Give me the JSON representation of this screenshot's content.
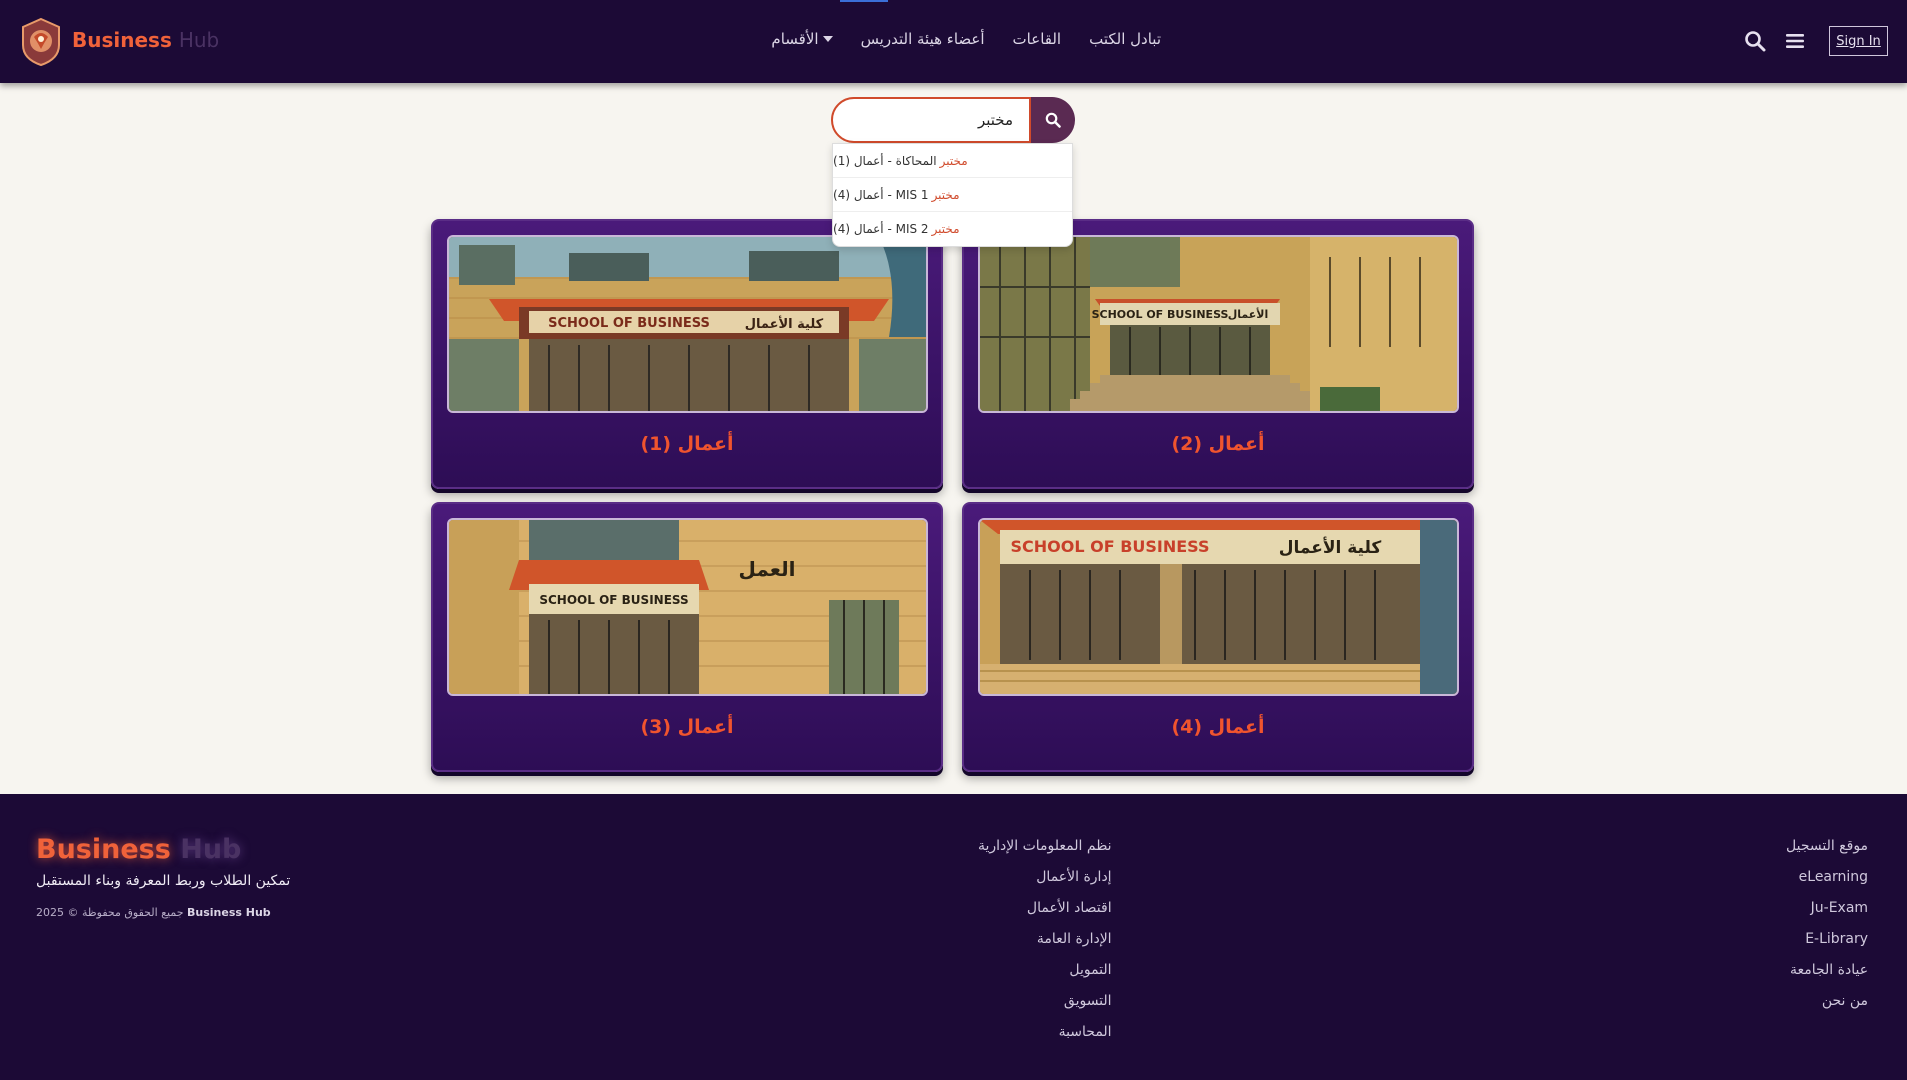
{
  "brand": {
    "name_primary": "Business",
    "name_secondary": "Hub"
  },
  "nav": {
    "links": [
      {
        "label": "تبادل الكتب"
      },
      {
        "label": "القاعات"
      },
      {
        "label": "أعضاء هيئة التدريس"
      },
      {
        "label": "الأقسام"
      }
    ],
    "signin_label": "Sign In"
  },
  "search": {
    "value": "مختبر",
    "suggestions": [
      {
        "highlight": "مختبر",
        "text": "المحاكاة - أعمال (1)"
      },
      {
        "highlight": "مختبر",
        "text": "MIS 1 - أعمال (4)"
      },
      {
        "highlight": "مختبر",
        "text": "MIS 2 - أعمال (4)"
      }
    ]
  },
  "cards": [
    {
      "title": "أعمال (1)",
      "sign_text": "SCHOOL OF BUSINESS",
      "sign_arabic": "كلية الأعمال"
    },
    {
      "title": "أعمال (2)",
      "sign_text": "SCHOOL OF BUSINESS",
      "sign_arabic": "الأعمال"
    },
    {
      "title": "أعمال (3)",
      "sign_text": "SCHOOL OF BUSINESS",
      "sign_arabic": "العمل"
    },
    {
      "title": "أعمال (4)",
      "sign_text": "SCHOOL OF BUSINESS",
      "sign_arabic": "كلية الأعمال"
    }
  ],
  "footer": {
    "tagline": "تمكين الطلاب وربط المعرفة وبناء المستقبل",
    "copyright_brand": "Business Hub",
    "copyright_text": "جميع الحقوق محفوظة © 2025",
    "departments": [
      "نظم المعلومات الإدارية",
      "إدارة الأعمال",
      "اقتصاد الأعمال",
      "الإدارة العامة",
      "التمويل",
      "التسويق",
      "المحاسبة"
    ],
    "links": [
      "موقع التسجيل",
      "eLearning",
      "Ju-Exam",
      "E-Library",
      "عيادة الجامعة",
      "من نحن"
    ]
  },
  "colors": {
    "navbar_bg": "#1c0a36",
    "accent_orange": "#f0623a",
    "card_bg": "#3a1268",
    "search_button": "#5a2a52",
    "page_bg": "#f7f5f0"
  },
  "icons": [
    "university-logo-icon",
    "search-icon",
    "menu-icon",
    "caret-down-icon"
  ]
}
